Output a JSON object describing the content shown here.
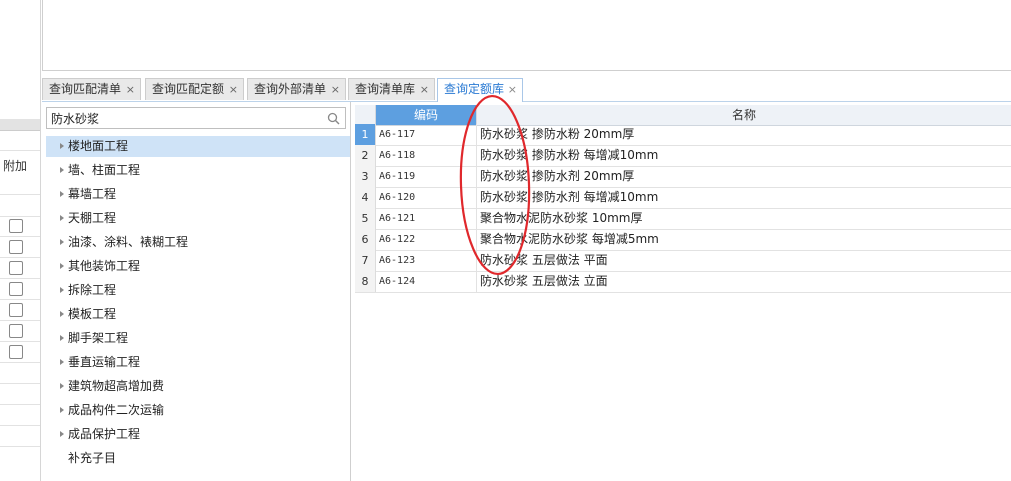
{
  "left_strip": {
    "label": "附加",
    "checkbox_count": 7
  },
  "tabs": [
    {
      "label": "查询匹配清单",
      "active": false
    },
    {
      "label": "查询匹配定额",
      "active": false
    },
    {
      "label": "查询外部清单",
      "active": false
    },
    {
      "label": "查询清单库",
      "active": false
    },
    {
      "label": "查询定额库",
      "active": true
    }
  ],
  "tab_close": "×",
  "search": {
    "value": "防水砂浆"
  },
  "tree": [
    {
      "label": "楼地面工程",
      "selected": true,
      "expandable": true
    },
    {
      "label": "墙、柱面工程",
      "selected": false,
      "expandable": true
    },
    {
      "label": "幕墙工程",
      "selected": false,
      "expandable": true
    },
    {
      "label": "天棚工程",
      "selected": false,
      "expandable": true
    },
    {
      "label": "油漆、涂料、裱糊工程",
      "selected": false,
      "expandable": true
    },
    {
      "label": "其他装饰工程",
      "selected": false,
      "expandable": true
    },
    {
      "label": "拆除工程",
      "selected": false,
      "expandable": true
    },
    {
      "label": "模板工程",
      "selected": false,
      "expandable": true
    },
    {
      "label": "脚手架工程",
      "selected": false,
      "expandable": true
    },
    {
      "label": "垂直运输工程",
      "selected": false,
      "expandable": true
    },
    {
      "label": "建筑物超高增加费",
      "selected": false,
      "expandable": true
    },
    {
      "label": "成品构件二次运输",
      "selected": false,
      "expandable": true
    },
    {
      "label": "成品保护工程",
      "selected": false,
      "expandable": true
    },
    {
      "label": "补充子目",
      "selected": false,
      "expandable": false
    }
  ],
  "grid": {
    "columns": {
      "code": "编码",
      "name": "名称"
    },
    "rows": [
      {
        "num": "1",
        "code": "A6-117",
        "name": "防水砂浆 掺防水粉 20mm厚",
        "selected": true
      },
      {
        "num": "2",
        "code": "A6-118",
        "name": "防水砂浆 掺防水粉 每增减10mm",
        "selected": false
      },
      {
        "num": "3",
        "code": "A6-119",
        "name": "防水砂浆 掺防水剂 20mm厚",
        "selected": false
      },
      {
        "num": "4",
        "code": "A6-120",
        "name": "防水砂浆 掺防水剂 每增减10mm",
        "selected": false
      },
      {
        "num": "5",
        "code": "A6-121",
        "name": "聚合物水泥防水砂浆 10mm厚",
        "selected": false
      },
      {
        "num": "6",
        "code": "A6-122",
        "name": "聚合物水泥防水砂浆 每增减5mm",
        "selected": false
      },
      {
        "num": "7",
        "code": "A6-123",
        "name": "防水砂浆 五层做法 平面",
        "selected": false
      },
      {
        "num": "8",
        "code": "A6-124",
        "name": "防水砂浆 五层做法 立面",
        "selected": false
      }
    ]
  },
  "colors": {
    "accent": "#2a7ad3",
    "header_selected": "#5d9fe0",
    "tree_selected": "#cfe3f7",
    "annotation": "#e0282c"
  },
  "icons": {
    "search": "search-icon",
    "tree_expand": "caret-right-icon",
    "tab_close": "close-icon"
  }
}
